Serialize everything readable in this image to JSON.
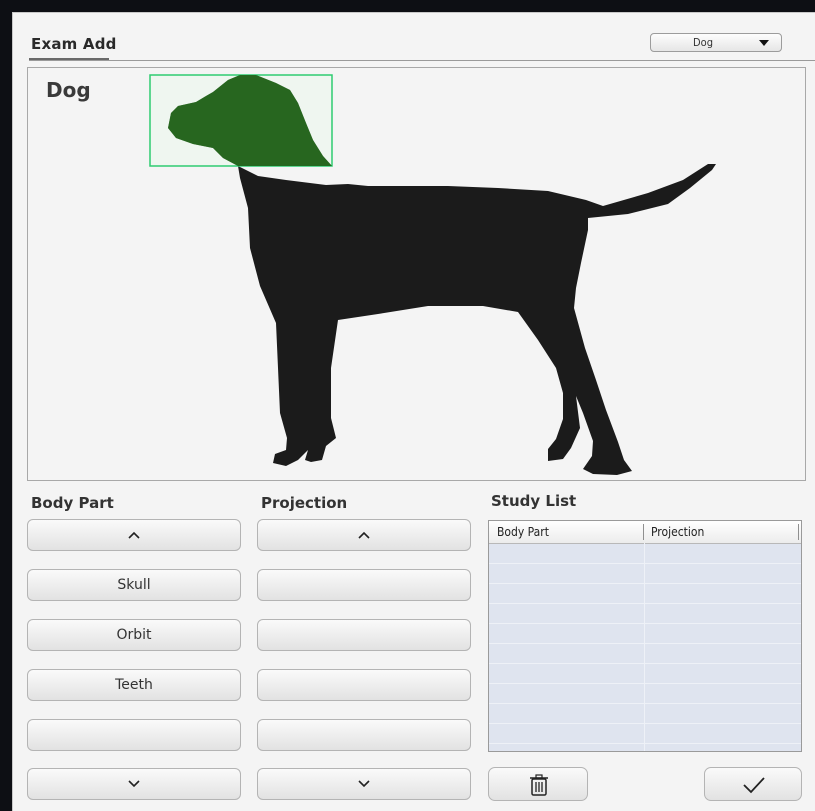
{
  "window": {
    "title": "Exam Add",
    "species_select": {
      "value": "Dog"
    }
  },
  "canvas": {
    "animal_label": "Dog",
    "selected_region": "head",
    "highlight_color": "#206018",
    "selection_box_color": "#2ecc71",
    "silhouette_color": "#1b1b1b"
  },
  "body_part": {
    "header": "Body Part",
    "items": [
      "Skull",
      "Orbit",
      "Teeth",
      ""
    ],
    "scroll_up_icon": "chevron-up-icon",
    "scroll_down_icon": "chevron-down-icon"
  },
  "projection": {
    "header": "Projection",
    "items": [
      "",
      "",
      "",
      ""
    ],
    "scroll_up_icon": "chevron-up-icon",
    "scroll_down_icon": "chevron-down-icon"
  },
  "study_list": {
    "header": "Study List",
    "columns": [
      "Body Part",
      "Projection"
    ],
    "rows": []
  },
  "actions": {
    "delete_icon": "trash-icon",
    "confirm_icon": "checkmark-icon"
  }
}
